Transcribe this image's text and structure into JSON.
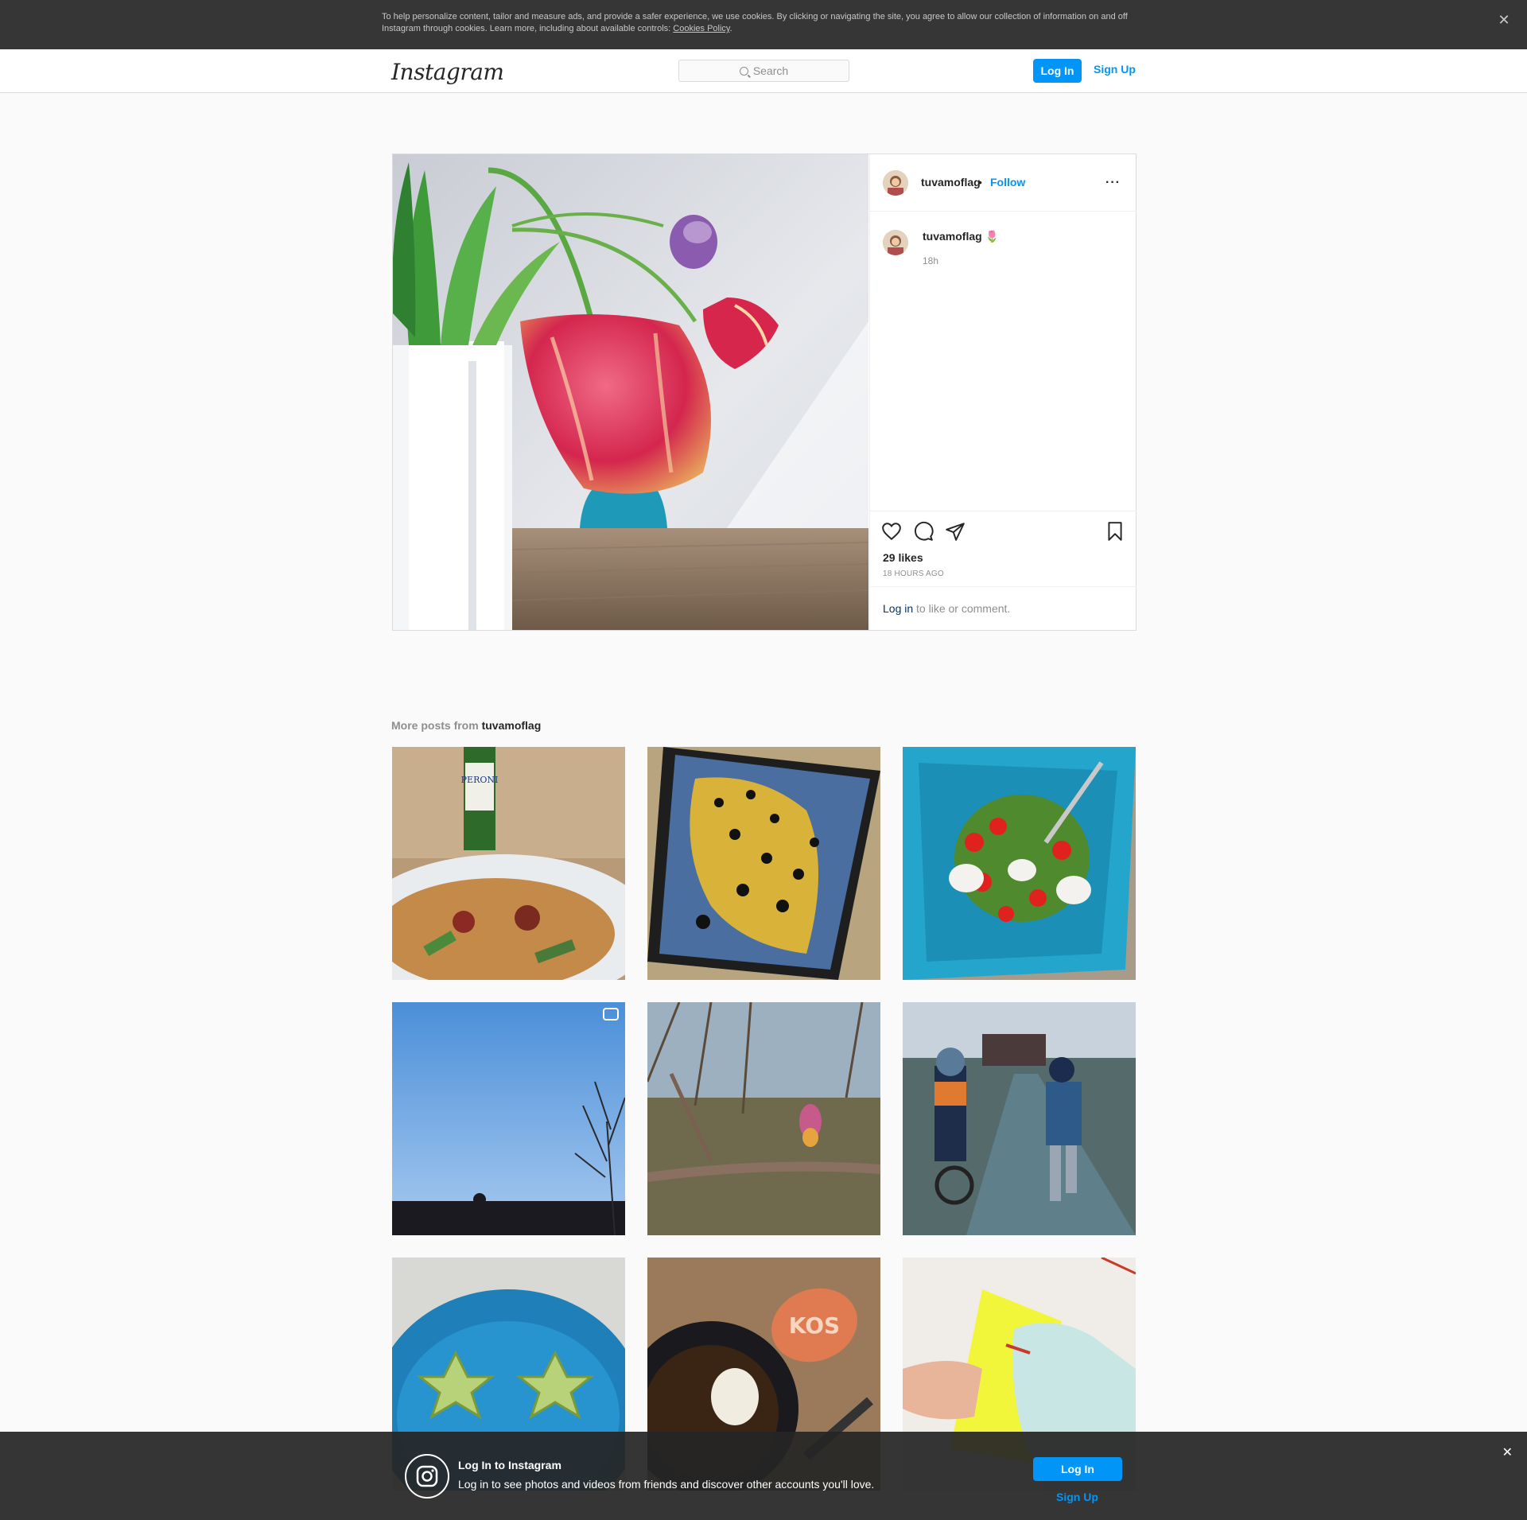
{
  "cookie_banner": {
    "text": "To help personalize content, tailor and measure ads, and provide a safer experience, we use cookies. By clicking or navigating the site, you agree to allow our collection of information on and off Instagram through cookies. Learn more, including about available controls: ",
    "policy_link": "Cookies Policy",
    "period": ".",
    "close_icon": "close-icon"
  },
  "nav": {
    "logo": "Instagram",
    "search_placeholder": "Search",
    "login_label": "Log In",
    "signup_label": "Sign Up"
  },
  "post": {
    "username": "tuvamoflag",
    "separator": "•",
    "follow_label": "Follow",
    "more_label": "···",
    "caption_username": "tuvamoflag 🌷",
    "caption_time": "18h",
    "likes": "29 likes",
    "posted_ago": "18 HOURS AGO",
    "login_link": "Log in",
    "login_suffix": " to like or comment.",
    "icons": [
      "heart-icon",
      "comment-icon",
      "share-icon",
      "bookmark-icon"
    ]
  },
  "more_posts": {
    "prefix": "More posts from ",
    "username": "tuvamoflag"
  },
  "bottom_bar": {
    "title": "Log In to Instagram",
    "subtitle": "Log in to see photos and videos from friends and discover other accounts you'll love.",
    "login_label": "Log In",
    "signup_label": "Sign Up",
    "close_icon": "close-icon"
  },
  "colors": {
    "accent": "#0095f6",
    "banner": "#363636",
    "background": "#fafafa"
  }
}
